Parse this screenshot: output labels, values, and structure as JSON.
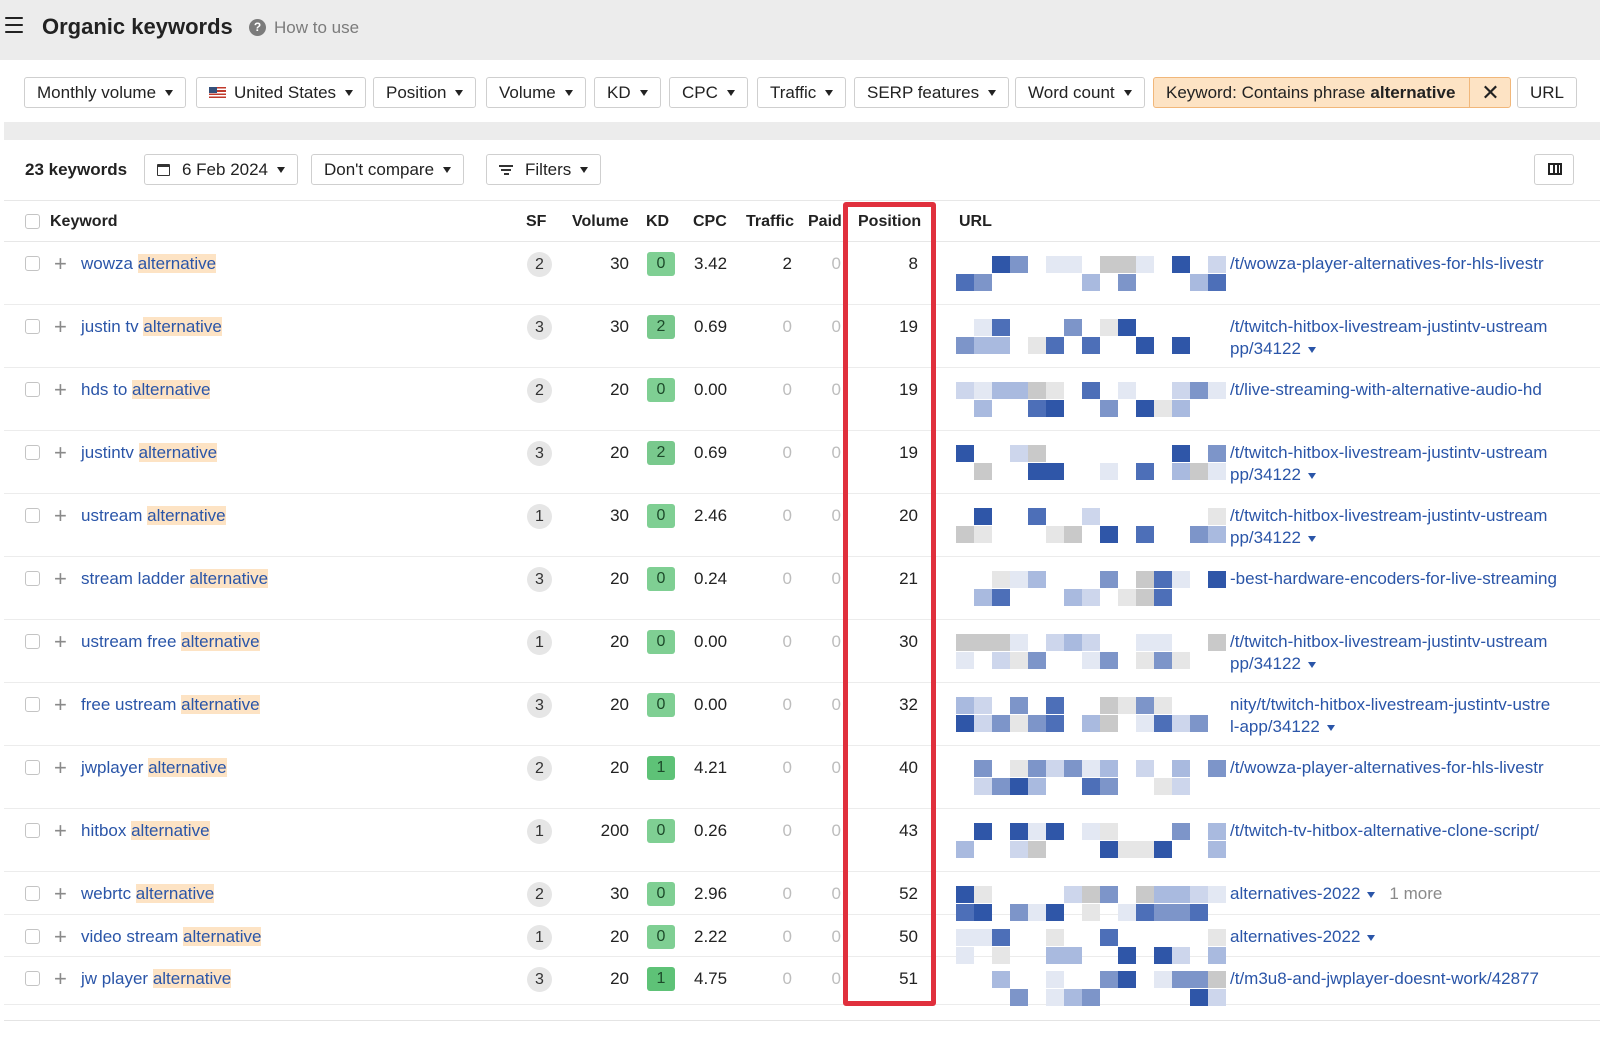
{
  "header": {
    "title": "Organic keywords",
    "help_label": "How to use",
    "help_glyph": "?"
  },
  "filters": {
    "monthly_volume": "Monthly volume",
    "country": "United States",
    "position": "Position",
    "volume": "Volume",
    "kd": "KD",
    "cpc": "CPC",
    "traffic": "Traffic",
    "serp_features": "SERP features",
    "word_count": "Word count",
    "active_filter_label": "Keyword: Contains phrase",
    "active_filter_value": "alternative",
    "url": "URL",
    "close_glyph": "✕"
  },
  "toolbar": {
    "count": "23 keywords",
    "date": "6 Feb 2024",
    "compare": "Don't compare",
    "filters": "Filters"
  },
  "columns": {
    "keyword": "Keyword",
    "sf": "SF",
    "volume": "Volume",
    "kd": "KD",
    "cpc": "CPC",
    "traffic": "Traffic",
    "paid": "Paid",
    "position": "Position",
    "url": "URL"
  },
  "colors": {
    "accent": "#2a55a8",
    "highlight": "#fde3c4",
    "kd_0": "#7fcf93",
    "kd_1": "#5ec277",
    "kd_2": "#79c98d",
    "position_box": "#e0303d"
  },
  "rows": [
    {
      "kw_prefix": "wowza ",
      "kw_hl": "alternative",
      "sf": "2",
      "volume": "30",
      "kd": "0",
      "cpc": "3.42",
      "traffic": "2",
      "paid": "0",
      "position": "8",
      "url1": "/t/wowza-player-alternatives-for-hls-livestr",
      "url2": "",
      "more": ""
    },
    {
      "kw_prefix": "justin tv ",
      "kw_hl": "alternative",
      "sf": "3",
      "volume": "30",
      "kd": "2",
      "cpc": "0.69",
      "traffic": "0",
      "paid": "0",
      "position": "19",
      "url1": "/t/twitch-hitbox-livestream-justintv-ustream",
      "url2": "pp/34122",
      "more": ""
    },
    {
      "kw_prefix": "hds to ",
      "kw_hl": "alternative",
      "sf": "2",
      "volume": "20",
      "kd": "0",
      "cpc": "0.00",
      "traffic": "0",
      "paid": "0",
      "position": "19",
      "url1": "/t/live-streaming-with-alternative-audio-hd",
      "url2": "",
      "more": ""
    },
    {
      "kw_prefix": "justintv ",
      "kw_hl": "alternative",
      "sf": "3",
      "volume": "20",
      "kd": "2",
      "cpc": "0.69",
      "traffic": "0",
      "paid": "0",
      "position": "19",
      "url1": "/t/twitch-hitbox-livestream-justintv-ustream",
      "url2": "pp/34122",
      "more": ""
    },
    {
      "kw_prefix": "ustream ",
      "kw_hl": "alternative",
      "sf": "1",
      "volume": "30",
      "kd": "0",
      "cpc": "2.46",
      "traffic": "0",
      "paid": "0",
      "position": "20",
      "url1": "/t/twitch-hitbox-livestream-justintv-ustream",
      "url2": "pp/34122",
      "more": ""
    },
    {
      "kw_prefix": "stream ladder ",
      "kw_hl": "alternative",
      "sf": "3",
      "volume": "20",
      "kd": "0",
      "cpc": "0.24",
      "traffic": "0",
      "paid": "0",
      "position": "21",
      "url1": "-best-hardware-encoders-for-live-streaming",
      "url2": "",
      "more": ""
    },
    {
      "kw_prefix": "ustream free ",
      "kw_hl": "alternative",
      "sf": "1",
      "volume": "20",
      "kd": "0",
      "cpc": "0.00",
      "traffic": "0",
      "paid": "0",
      "position": "30",
      "url1": "/t/twitch-hitbox-livestream-justintv-ustream",
      "url2": "pp/34122",
      "more": ""
    },
    {
      "kw_prefix": "free ustream ",
      "kw_hl": "alternative",
      "sf": "3",
      "volume": "20",
      "kd": "0",
      "cpc": "0.00",
      "traffic": "0",
      "paid": "0",
      "position": "32",
      "url1": "nity/t/twitch-hitbox-livestream-justintv-ustre",
      "url2": "l-app/34122",
      "more": ""
    },
    {
      "kw_prefix": "jwplayer ",
      "kw_hl": "alternative",
      "sf": "2",
      "volume": "20",
      "kd": "1",
      "cpc": "4.21",
      "traffic": "0",
      "paid": "0",
      "position": "40",
      "url1": "/t/wowza-player-alternatives-for-hls-livestr",
      "url2": "",
      "more": ""
    },
    {
      "kw_prefix": "hitbox ",
      "kw_hl": "alternative",
      "sf": "1",
      "volume": "200",
      "kd": "0",
      "cpc": "0.26",
      "traffic": "0",
      "paid": "0",
      "position": "43",
      "url1": "/t/twitch-tv-hitbox-alternative-clone-script/",
      "url2": "",
      "more": ""
    },
    {
      "kw_prefix": "webrtc ",
      "kw_hl": "alternative",
      "sf": "2",
      "volume": "30",
      "kd": "0",
      "cpc": "2.96",
      "traffic": "0",
      "paid": "0",
      "position": "52",
      "url1": "alternatives-2022",
      "url2": "",
      "more": "1 more"
    },
    {
      "kw_prefix": "video stream ",
      "kw_hl": "alternative",
      "sf": "1",
      "volume": "20",
      "kd": "0",
      "cpc": "2.22",
      "traffic": "0",
      "paid": "0",
      "position": "50",
      "url1": "alternatives-2022",
      "url2": "",
      "more": ""
    },
    {
      "kw_prefix": "jw player ",
      "kw_hl": "alternative",
      "sf": "3",
      "volume": "20",
      "kd": "1",
      "cpc": "4.75",
      "traffic": "0",
      "paid": "0",
      "position": "51",
      "url1": "/t/m3u8-and-jwplayer-doesnt-work/42877",
      "url2": "",
      "more": ""
    }
  ]
}
